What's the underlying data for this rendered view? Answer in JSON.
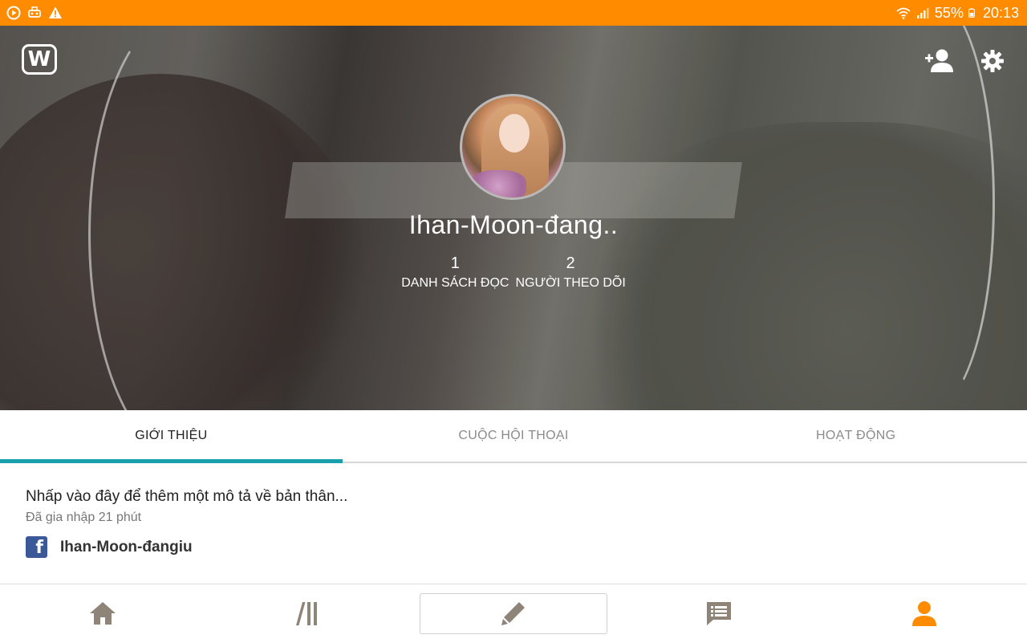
{
  "status_bar": {
    "battery": "55%",
    "time": "20:13",
    "icons_left": [
      "media-icon",
      "game-icon",
      "warning-icon"
    ],
    "icons_right": [
      "wifi-icon",
      "signal-icon",
      "battery-icon"
    ]
  },
  "header": {
    "logo": "W",
    "icons": [
      "wattpad-logo-icon",
      "add-user-icon",
      "settings-icon"
    ]
  },
  "profile": {
    "username": "Ihan-Moon-đang..",
    "stats": [
      {
        "value": "1",
        "label": "DANH SÁCH ĐỌC"
      },
      {
        "value": "2",
        "label": "NGƯỜI THEO DÕI"
      }
    ]
  },
  "tabs": [
    {
      "label": "GIỚI THIỆU",
      "active": true
    },
    {
      "label": "CUỘC HỘI THOẠI",
      "active": false
    },
    {
      "label": "HOẠT ĐỘNG",
      "active": false
    }
  ],
  "about": {
    "description_placeholder": "Nhấp vào đây để thêm một mô tả về bản thân...",
    "joined": "Đã gia nhập 21 phút",
    "facebook_glyph": "f",
    "facebook_name": "Ihan-Moon-đangiu"
  },
  "bottom_nav": [
    {
      "icon": "home-icon",
      "active": false
    },
    {
      "icon": "library-icon",
      "active": false
    },
    {
      "icon": "pencil-icon",
      "active": false
    },
    {
      "icon": "messages-icon",
      "active": false
    },
    {
      "icon": "profile-icon",
      "active": true
    }
  ],
  "colors": {
    "status_bar": "#ff8c00",
    "tab_indicator": "#1aa0ad",
    "nav_icon": "#8e8478",
    "nav_active": "#ff8c00",
    "facebook": "#3b5998"
  }
}
